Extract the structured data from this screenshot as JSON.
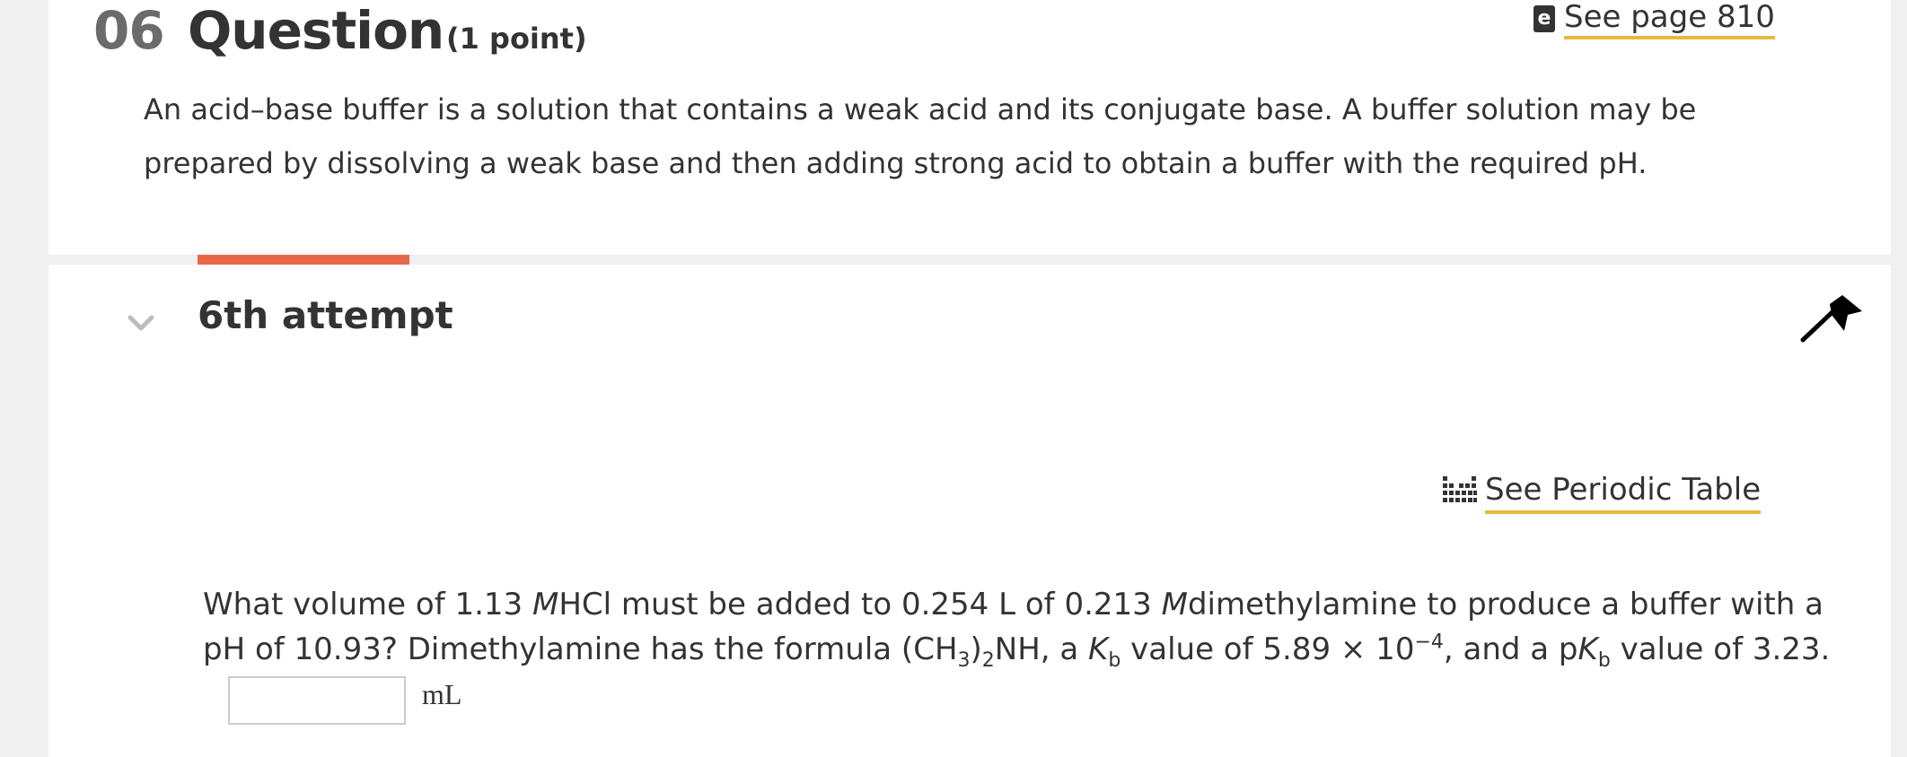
{
  "header": {
    "question_number": "06",
    "question_word": "Question",
    "points": "(1 point)",
    "see_page_label": "See page 810",
    "ebook_icon_glyph": "e",
    "intro_text": "An acid–base buffer is a solution that contains a weak acid and its conjugate base. A buffer solution may be prepared by dissolving a weak base and then adding strong acid to obtain a buffer with the required pH."
  },
  "attempt": {
    "title": "6th attempt",
    "collapse_icon": "chevron-down-icon",
    "flag_icon": "flag-icon"
  },
  "periodic": {
    "label": "See Periodic Table",
    "icon": "periodic-table-icon"
  },
  "question": {
    "t1": "What volume of 1.13 ",
    "m1": "M",
    "t2": "HCl must be added to 0.254 L of 0.213 ",
    "m2": "M",
    "t3": "dimethylamine to produce a buffer with a pH of 10.93? Dimethylamine has the formula (CH",
    "sub1": "3",
    "t4": ")",
    "sub2": "2",
    "t5": "NH, a ",
    "k1": "K",
    "kb1": "b",
    "t6": " value of 5.89 × 10",
    "exp": "−4",
    "t7": ", and a p",
    "k2": "K",
    "kb2": "b",
    "t8": " value of 3.23."
  },
  "answer": {
    "value": "",
    "unit": "mL"
  },
  "colors": {
    "accent_underline": "#e6b93b",
    "attempt_tab": "#e8684a",
    "text": "#333333",
    "background": "#f0f0f0"
  }
}
